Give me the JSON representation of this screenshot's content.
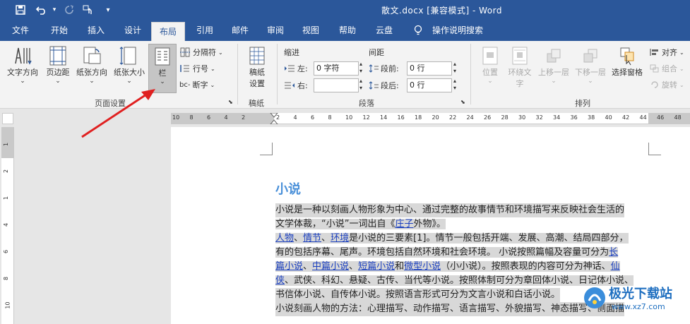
{
  "titlebar": {
    "title": "散文.docx [兼容模式] - Word"
  },
  "tabs": [
    {
      "label": "文件"
    },
    {
      "label": "开始"
    },
    {
      "label": "插入"
    },
    {
      "label": "设计"
    },
    {
      "label": "布局"
    },
    {
      "label": "引用"
    },
    {
      "label": "邮件"
    },
    {
      "label": "审阅"
    },
    {
      "label": "视图"
    },
    {
      "label": "帮助"
    },
    {
      "label": "云盘"
    },
    {
      "label": "操作说明搜索"
    }
  ],
  "ribbon": {
    "page_setup": {
      "text_direction": "文字方向",
      "margins": "页边距",
      "orientation": "纸张方向",
      "size": "纸张大小",
      "columns": "栏",
      "breaks": "分隔符",
      "line_numbers": "行号",
      "hyphenation": "断字",
      "group_label": "页面设置"
    },
    "manuscript": {
      "button_line1": "稿纸",
      "button_line2": "设置",
      "group_label": "稿纸"
    },
    "paragraph": {
      "indent_title": "缩进",
      "spacing_title": "间距",
      "left_label": "左:",
      "left_value": "0 字符",
      "right_label": "右:",
      "right_value": "",
      "before_label": "段前:",
      "before_value": "0 行",
      "after_label": "段后:",
      "after_value": "0 行",
      "group_label": "段落"
    },
    "arrange": {
      "position": "位置",
      "wrap_line1": "环绕文",
      "wrap_line2": "字",
      "bring_forward": "上移一层",
      "send_backward": "下移一层",
      "selection_pane": "选择窗格",
      "align": "对齐",
      "group": "组合",
      "rotate": "旋转",
      "group_label": "排列"
    }
  },
  "ruler": {
    "h_ticks": [
      "10",
      "8",
      "6",
      "4",
      "2",
      "",
      "2",
      "4",
      "6",
      "8",
      "10",
      "12",
      "14",
      "16",
      "18",
      "20",
      "22",
      "24",
      "26",
      "28",
      "30",
      "32",
      "34",
      "36",
      "38",
      "40",
      "42",
      "44",
      "46",
      "48"
    ],
    "v_ticks": [
      "1",
      "2",
      "1",
      "4",
      "6",
      "8",
      "10"
    ]
  },
  "document": {
    "heading": "小说",
    "line1": "小说是一种以刻画人物形象为中心、通过完整的故事情节和环境描写来反映社会生活的",
    "line2a": "文学体裁，“小说”一词出自《",
    "line2_link": "庄子",
    "line2b": "外物》。",
    "line3_link1": "人物",
    "line3_sep1": "、",
    "line3_link2": "情节",
    "line3_sep2": "、",
    "line3_link3": "环境",
    "line3_rest": "是小说的三要素[1]。情节一般包括开端、发展、高潮、结局四部分，",
    "line4a": "有的包括序幕、尾声。环境包括自然环境和社会环境。 小说按照篇幅及容量可分为",
    "line4_link": "长",
    "line5_link1": "篇小说",
    "line5_sep1": "、",
    "line5_link2": "中篇小说",
    "line5_sep2": "、",
    "line5_link3": "短篇小说",
    "line5_mid": "和",
    "line5_link4": "微型小说",
    "line5_rest": "（小小说）。按照表现的内容可分为神话、",
    "line5_link5": "仙",
    "line6_link": "侠",
    "line6_rest": "、武侠、科幻、悬疑、古传、当代等小说。按照体制可分为章回体小说、日记体小说、",
    "line7": "书信体小说、自传体小说。按照语言形式可分为文言小说和白话小说。",
    "line8": "小说刻画人物的方法：心理描写、动作描写、语言描写、外貌描写、神态描写、侧面描"
  },
  "watermark": {
    "text": "极光下载站",
    "url": "www.xz7.com"
  },
  "colors": {
    "brand": "#2b579a",
    "heading": "#4a90d9",
    "link": "#1a3fbf",
    "arrow": "#e02020"
  }
}
